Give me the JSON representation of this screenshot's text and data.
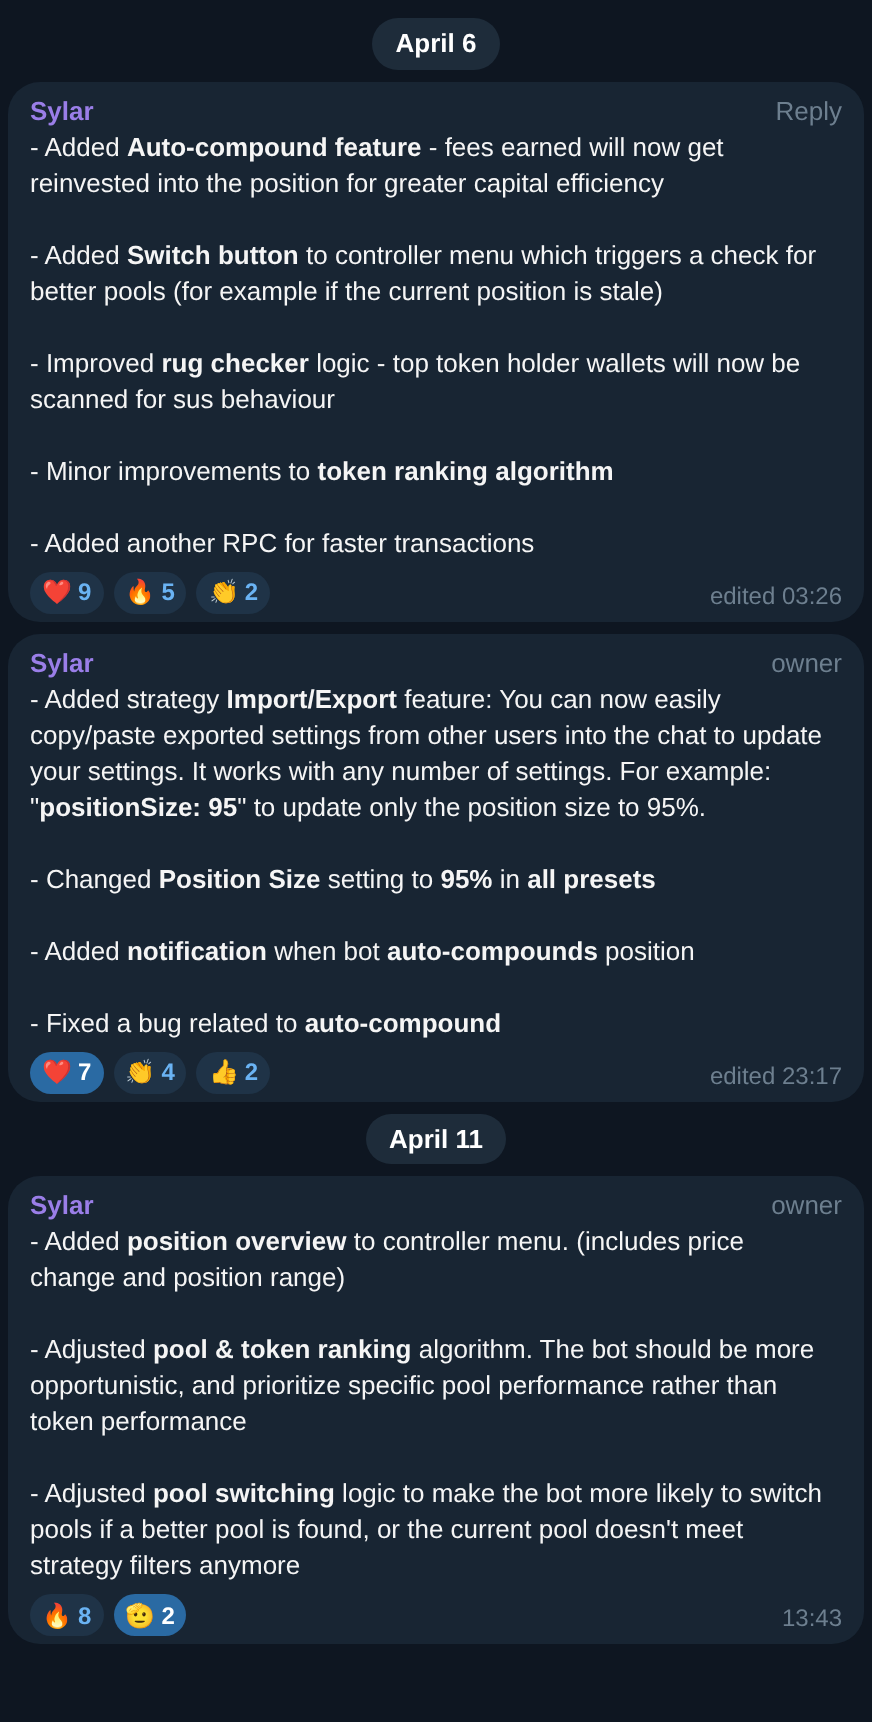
{
  "feed": [
    {
      "kind": "date",
      "label": "April 6"
    },
    {
      "kind": "message",
      "author": "Sylar",
      "tag": "Reply",
      "paragraphs": [
        "- Added **Auto-compound feature** - fees earned will now get reinvested into the position for greater capital efficiency",
        "- Added **Switch button** to controller menu which triggers a check for better pools (for example if the current position is stale)",
        "- Improved **rug checker** logic - top token holder wallets will now be scanned for sus behaviour",
        "- Minor improvements to **token ranking algorithm**",
        "- Added another RPC for faster transactions"
      ],
      "reactions": [
        {
          "emoji": "❤️",
          "count": "9",
          "selected": false
        },
        {
          "emoji": "🔥",
          "count": "5",
          "selected": false
        },
        {
          "emoji": "👏",
          "count": "2",
          "selected": false
        }
      ],
      "time": "edited 03:26"
    },
    {
      "kind": "message",
      "author": "Sylar",
      "tag": "owner",
      "paragraphs": [
        "- Added strategy **Import/Export** feature: You can now easily copy/paste exported settings from other users into the chat to update your settings. It works with any number of settings. For example: \"**positionSize: 95**\" to update only the position size to 95%.",
        "- Changed **Position Size** setting to **95%** in **all presets**",
        "- Added **notification** when bot **auto-compounds** position",
        "- Fixed a bug related to **auto-compound**"
      ],
      "reactions": [
        {
          "emoji": "❤️",
          "count": "7",
          "selected": true
        },
        {
          "emoji": "👏",
          "count": "4",
          "selected": false
        },
        {
          "emoji": "👍",
          "count": "2",
          "selected": false
        }
      ],
      "time": "edited 23:17"
    },
    {
      "kind": "date",
      "label": "April 11"
    },
    {
      "kind": "message",
      "author": "Sylar",
      "tag": "owner",
      "paragraphs": [
        "- Added **position overview** to controller menu. (includes price change and position range)",
        "- Adjusted **pool & token ranking** algorithm. The bot should be more opportunistic, and prioritize specific pool performance rather than token performance",
        "- Adjusted **pool switching** logic to make the bot more likely to switch pools if a better pool is found, or the current pool doesn't meet strategy filters anymore"
      ],
      "reactions": [
        {
          "emoji": "🔥",
          "count": "8",
          "selected": false
        },
        {
          "emoji": "🫡",
          "count": "2",
          "selected": true
        }
      ],
      "time": "13:43"
    }
  ]
}
